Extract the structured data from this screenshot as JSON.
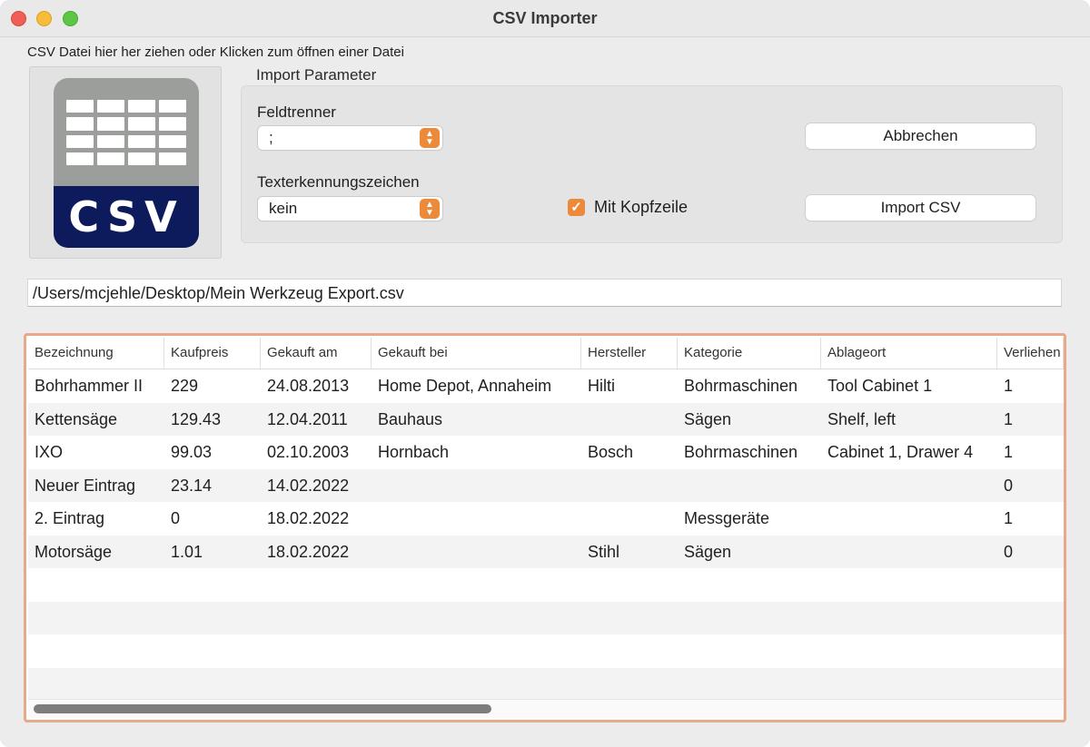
{
  "window": {
    "title": "CSV Importer",
    "buttons": [
      "close",
      "minimize",
      "zoom"
    ]
  },
  "drop_hint": "CSV Datei hier her ziehen oder Klicken zum öffnen einer Datei",
  "csv_icon": {
    "text": "CSV",
    "colors": {
      "top": "#9c9e9c",
      "band": "#0d1a5c"
    }
  },
  "params": {
    "group_label": "Import Parameter",
    "field_separator": {
      "label": "Feldtrenner",
      "value": ";"
    },
    "text_qualifier": {
      "label": "Texterkennungszeichen",
      "value": "kein"
    },
    "header_row": {
      "label": "Mit Kopfzeile",
      "checked": true
    },
    "cancel_label": "Abbrechen",
    "import_label": "Import CSV"
  },
  "file_path": "/Users/mcjehle/Desktop/Mein Werkzeug Export.csv",
  "table": {
    "headers": [
      "Bezeichnung",
      "Kaufpreis",
      "Gekauft am",
      "Gekauft bei",
      "Hersteller",
      "Kategorie",
      "Ablageort",
      "Verliehen"
    ],
    "rows": [
      [
        "Bohrhammer II",
        "229",
        "24.08.2013",
        "Home Depot, Annaheim",
        "Hilti",
        "Bohrmaschinen",
        "Tool Cabinet 1",
        "1"
      ],
      [
        "Kettensäge",
        "129.43",
        "12.04.2011",
        "Bauhaus",
        "",
        "Sägen",
        "Shelf, left",
        "1"
      ],
      [
        "IXO",
        "99.03",
        "02.10.2003",
        "Hornbach",
        "Bosch",
        "Bohrmaschinen",
        "Cabinet 1, Drawer 4",
        "1"
      ],
      [
        "Neuer Eintrag",
        "23.14",
        "14.02.2022",
        "",
        "",
        "",
        "",
        "0"
      ],
      [
        "2. Eintrag",
        "0",
        "18.02.2022",
        "",
        "",
        "Messgeräte",
        "",
        "1"
      ],
      [
        "Motorsäge",
        "1.01",
        "18.02.2022",
        "",
        "Stihl",
        "Sägen",
        "",
        "0"
      ]
    ],
    "empty_rows": 4
  },
  "accent_color": "#ec8a3a",
  "selection_border_color": "#e6a98a"
}
